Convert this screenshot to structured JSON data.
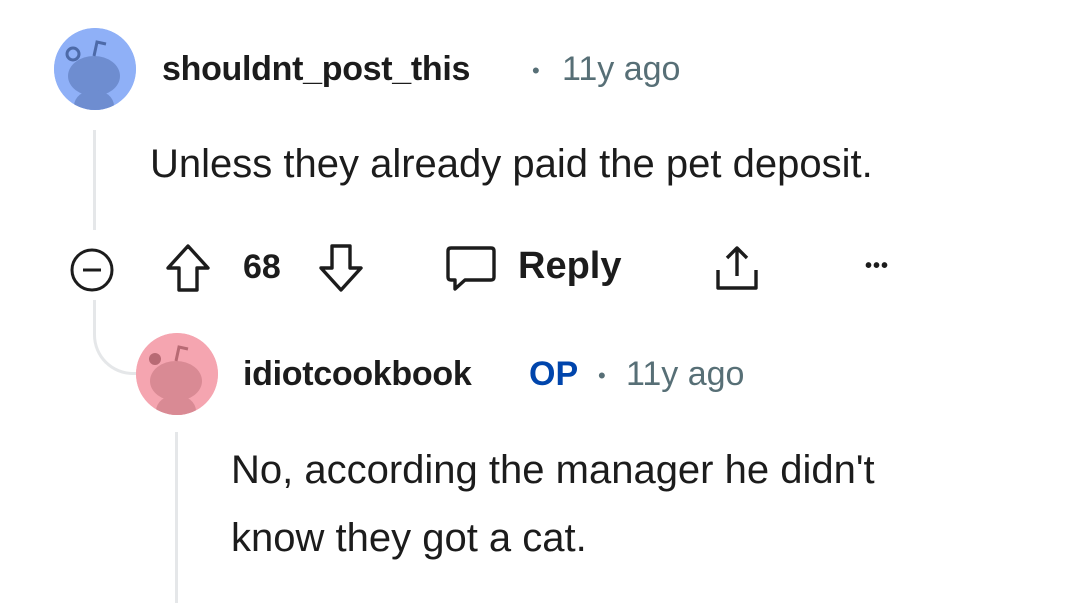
{
  "comment": {
    "username": "shouldnt_post_this",
    "separator": "•",
    "time": "11y ago",
    "body": "Unless they already paid the pet deposit.",
    "avatar_color": "#8fb0f7",
    "actions": {
      "collapse_icon": "minus-circle-icon",
      "upvote_icon": "arrow-up-icon",
      "score": "68",
      "downvote_icon": "arrow-down-icon",
      "reply_icon": "speech-bubble-icon",
      "reply_label": "Reply",
      "share_icon": "share-icon",
      "more_icon": "ellipsis-icon",
      "more_label": "•••"
    }
  },
  "reply": {
    "username": "idiotcookbook",
    "op_badge": "OP",
    "separator": "•",
    "time": "11y ago",
    "body_lines": [
      "No, according the manager he didn't",
      "know they got a cat."
    ],
    "avatar_color": "#f5a5b0"
  },
  "colors": {
    "text": "#1c1c1c",
    "meta": "#576f76",
    "op": "#0045ac",
    "thread": "#e5e7e9"
  }
}
